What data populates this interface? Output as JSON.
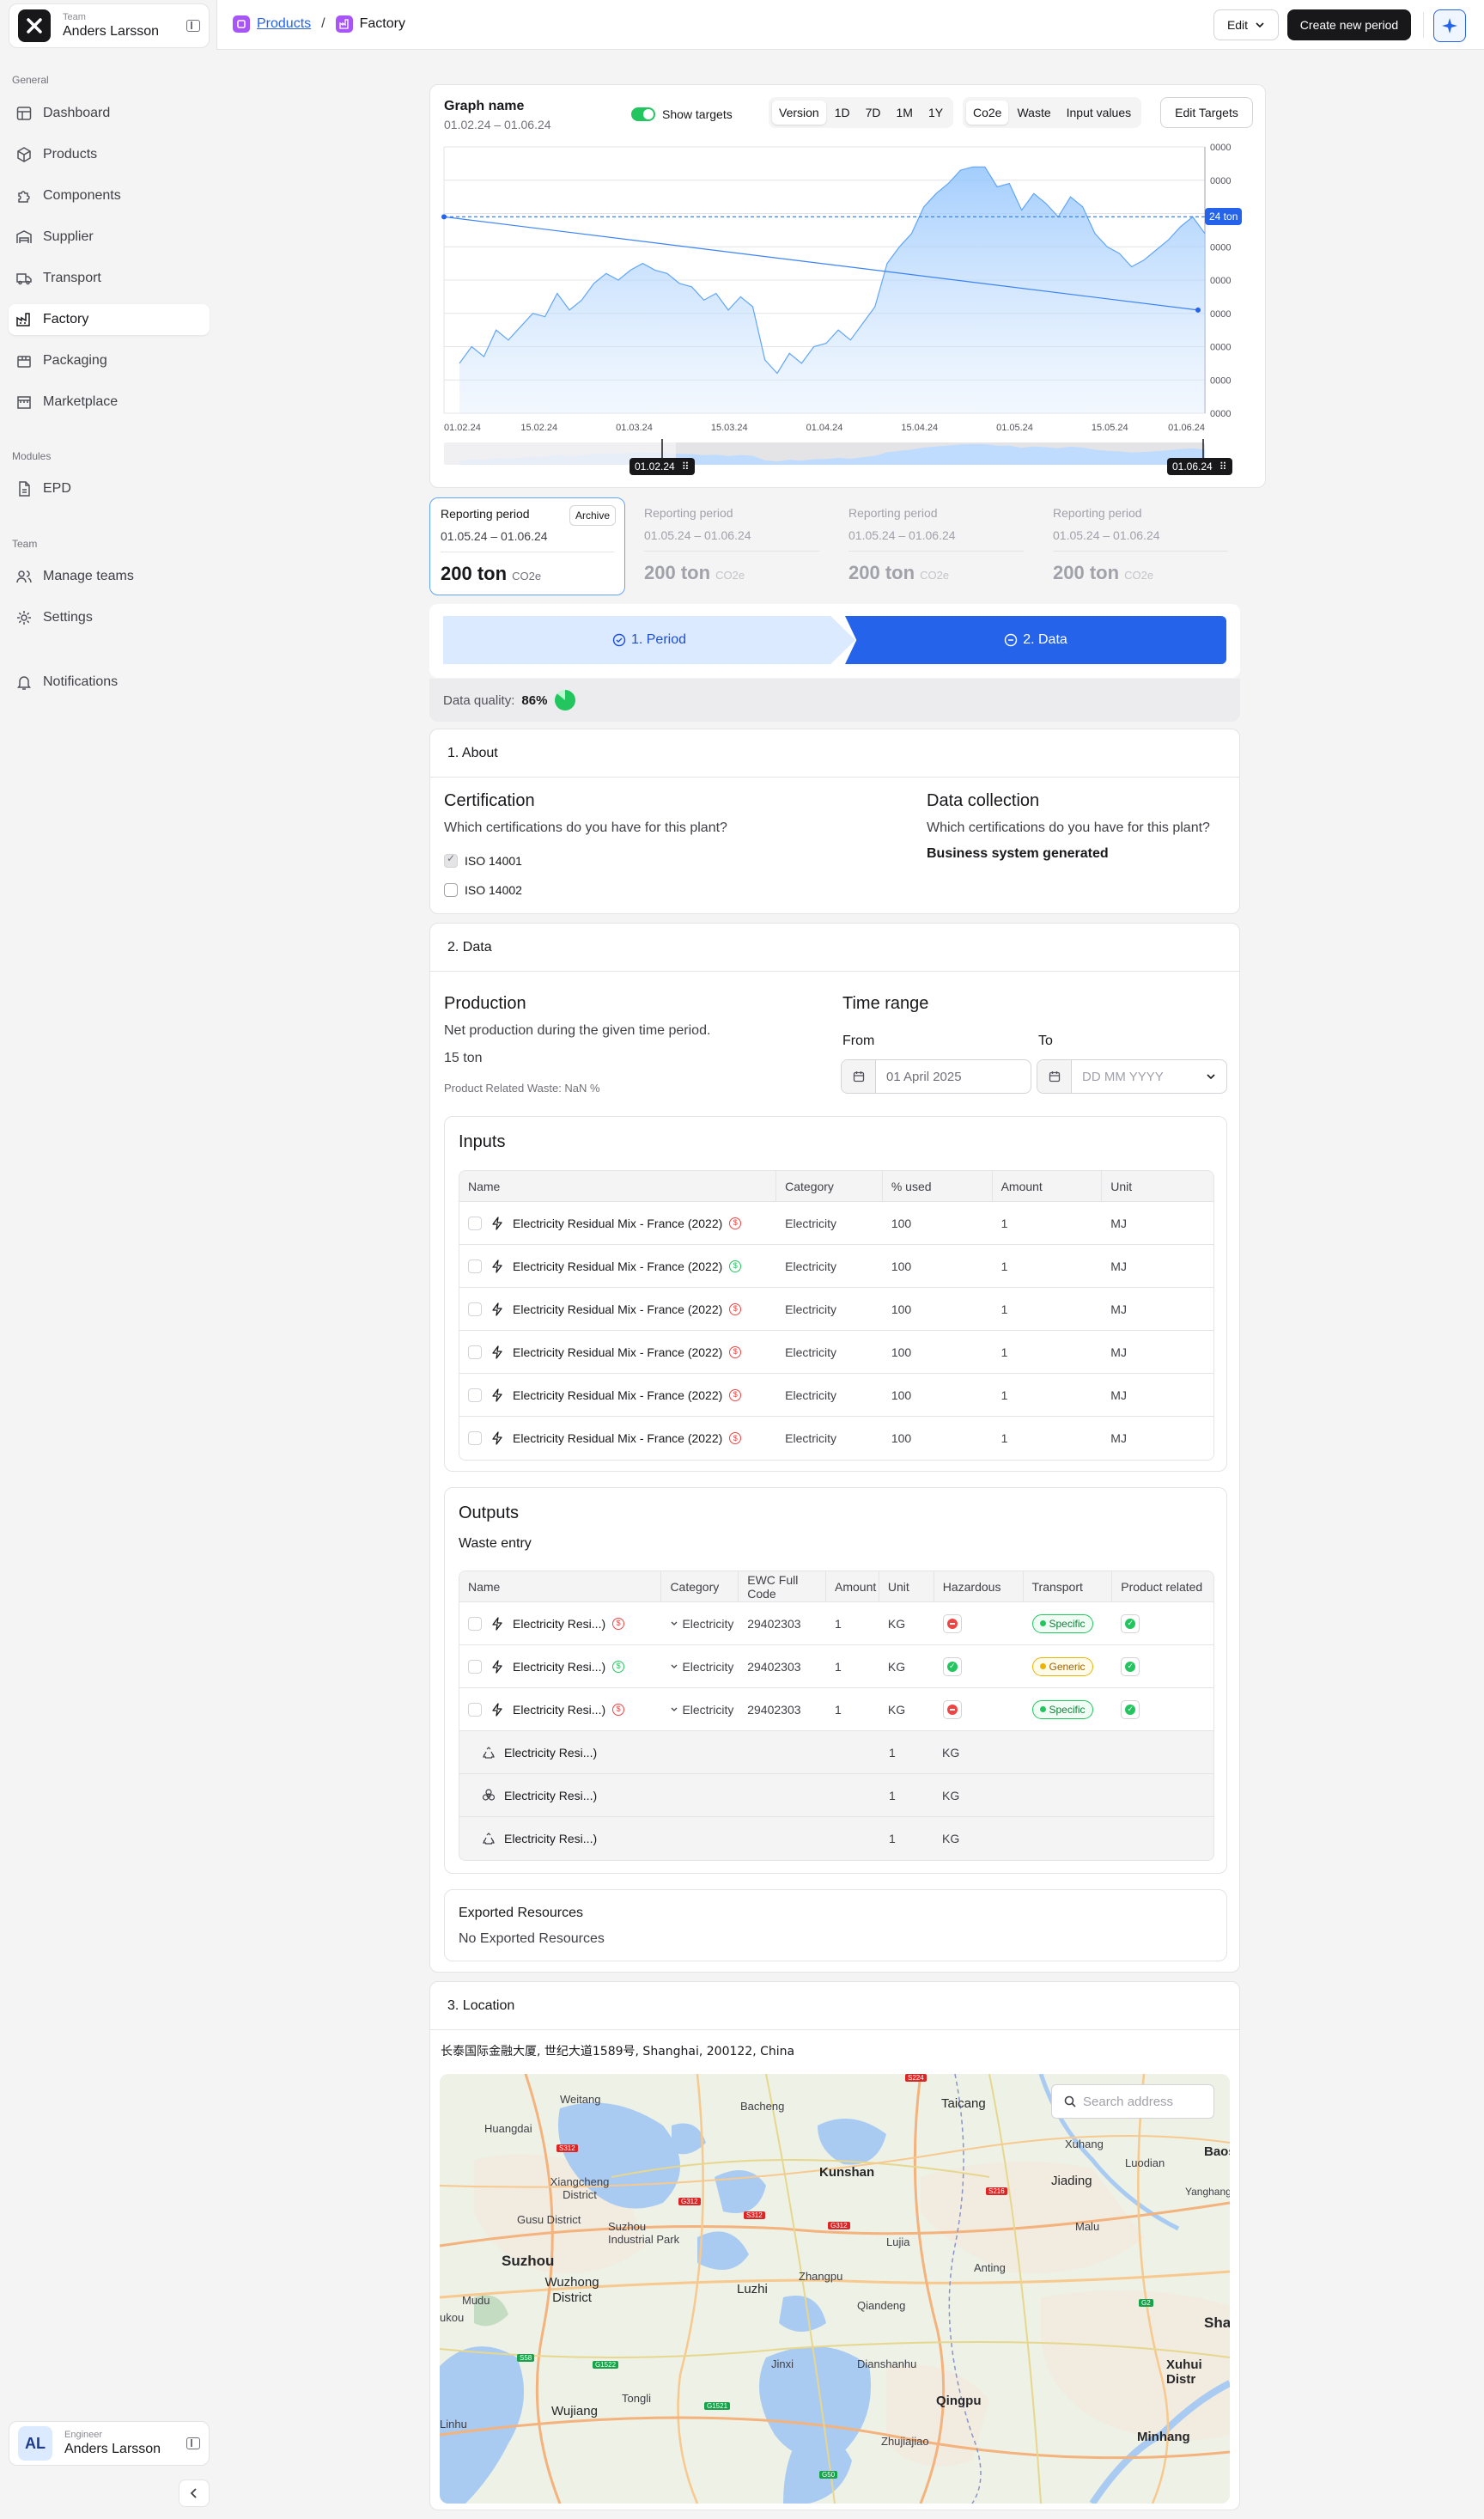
{
  "sidebar": {
    "team_small": "Team",
    "team_name": "Anders Larsson",
    "general_label": "General",
    "nav": [
      {
        "label": "Dashboard",
        "icon": "layout-icon"
      },
      {
        "label": "Products",
        "icon": "box-icon"
      },
      {
        "label": "Components",
        "icon": "puzzle-icon"
      },
      {
        "label": "Supplier",
        "icon": "warehouse-icon"
      },
      {
        "label": "Transport",
        "icon": "truck-icon"
      },
      {
        "label": "Factory",
        "icon": "factory-icon"
      },
      {
        "label": "Packaging",
        "icon": "package-icon"
      },
      {
        "label": "Marketplace",
        "icon": "store-icon"
      }
    ],
    "modules_label": "Modules",
    "modules": [
      {
        "label": "EPD",
        "icon": "document-icon"
      }
    ],
    "team_label": "Team",
    "team_nav": [
      {
        "label": "Manage teams",
        "icon": "users-icon"
      },
      {
        "label": "Settings",
        "icon": "gear-icon"
      }
    ],
    "notifications": "Notifications",
    "user_role": "Engineer",
    "user_name": "Anders Larsson",
    "user_initials": "AL"
  },
  "topbar": {
    "crumb_parent": "Products",
    "crumb_separator": "/",
    "crumb_current": "Factory",
    "edit_label": "Edit",
    "create_label": "Create new period"
  },
  "graph": {
    "title": "Graph name",
    "range": "01.02.24 – 01.06.24",
    "show_targets": "Show targets",
    "ranges": [
      "Version",
      "1D",
      "7D",
      "1M",
      "1Y"
    ],
    "metrics": [
      "Co2e",
      "Waste",
      "Input values"
    ],
    "edit_targets": "Edit Targets",
    "target_badge": "24 ton",
    "brush_start": "01.02.24",
    "brush_end": "01.06.24"
  },
  "chart_data": {
    "type": "area",
    "title": "Graph name",
    "x": [
      "01.02.24",
      "15.02.24",
      "01.03.24",
      "15.03.24",
      "01.04.24",
      "15.04.24",
      "01.05.24",
      "15.05.24",
      "01.06.24"
    ],
    "ytick_labels": [
      "0000",
      "0000",
      "0000",
      "0000",
      "0000",
      "0000",
      "0000",
      "0000",
      "0000"
    ],
    "ylim": [
      0,
      8
    ],
    "series": [
      {
        "values": [
          1.5,
          2.0,
          1.7,
          2.5,
          2.2,
          2.6,
          3.0,
          2.9,
          3.6,
          3.1,
          3.4,
          3.9,
          4.2,
          4.0,
          4.3,
          4.5,
          4.3,
          4.2,
          3.9,
          3.8,
          3.4,
          3.6,
          3.1,
          3.5,
          3.2,
          1.6,
          1.2,
          1.8,
          1.5,
          2.0,
          2.1,
          2.5,
          2.2,
          2.7,
          3.2,
          4.5,
          5.0,
          5.4,
          6.2,
          6.6,
          6.9,
          7.3,
          7.4,
          7.4,
          6.8,
          6.9,
          6.1,
          6.6,
          6.3,
          5.9,
          6.5,
          6.2,
          5.4,
          5.0,
          4.8,
          4.4,
          4.6,
          4.9,
          5.2,
          5.6,
          5.9,
          5.4
        ]
      },
      {
        "values": [
          5.9,
          3.1
        ]
      }
    ],
    "targets": [
      5.9
    ],
    "grid": true
  },
  "periods": [
    {
      "label": "Reporting period",
      "range": "01.05.24 – 01.06.24",
      "value": "200 ton",
      "unit": "CO2e",
      "archive": "Archive"
    },
    {
      "label": "Reporting period",
      "range": "01.05.24 – 01.06.24",
      "value": "200 ton",
      "unit": "CO2e"
    },
    {
      "label": "Reporting period",
      "range": "01.05.24 – 01.06.24",
      "value": "200 ton",
      "unit": "CO2e"
    },
    {
      "label": "Reporting period",
      "range": "01.05.24 – 01.06.24",
      "value": "200 ton",
      "unit": "CO2e"
    }
  ],
  "steps": {
    "step1": "1. Period",
    "step2": "2. Data"
  },
  "data_quality": {
    "label": "Data quality:",
    "value": "86%",
    "fraction": 0.86
  },
  "about": {
    "title": "1. About",
    "cert_title": "Certification",
    "cert_question": "Which certifications do you have for this plant?",
    "certs": [
      {
        "label": "ISO 14001",
        "checked": true
      },
      {
        "label": "ISO 14002",
        "checked": false
      }
    ],
    "dc_title": "Data collection",
    "dc_question": "Which certifications do you have for this plant?",
    "dc_value": "Business system generated"
  },
  "data": {
    "title": "2. Data",
    "prod_title": "Production",
    "prod_desc": "Net production during the given time period.",
    "prod_value": "15 ton",
    "prod_waste": "Product Related Waste: NaN %",
    "time_title": "Time range",
    "from_label": "From",
    "from_value": "01 April 2025",
    "to_label": "To",
    "to_placeholder": "DD MM YYYY"
  },
  "inputs": {
    "title": "Inputs",
    "columns": [
      "Name",
      "Category",
      "% used",
      "Amount",
      "Unit"
    ],
    "rows": [
      {
        "name": "Electricity Residual Mix - France (2022)",
        "flag": "red",
        "category": "Electricity",
        "used": "100",
        "amount": "1",
        "unit": "MJ"
      },
      {
        "name": "Electricity Residual Mix - France (2022)",
        "flag": "green",
        "category": "Electricity",
        "used": "100",
        "amount": "1",
        "unit": "MJ"
      },
      {
        "name": "Electricity Residual Mix - France (2022)",
        "flag": "red",
        "category": "Electricity",
        "used": "100",
        "amount": "1",
        "unit": "MJ"
      },
      {
        "name": "Electricity Residual Mix - France (2022)",
        "flag": "red",
        "category": "Electricity",
        "used": "100",
        "amount": "1",
        "unit": "MJ"
      },
      {
        "name": "Electricity Residual Mix - France (2022)",
        "flag": "red",
        "category": "Electricity",
        "used": "100",
        "amount": "1",
        "unit": "MJ"
      },
      {
        "name": "Electricity Residual Mix - France (2022)",
        "flag": "red",
        "category": "Electricity",
        "used": "100",
        "amount": "1",
        "unit": "MJ"
      }
    ]
  },
  "outputs": {
    "title": "Outputs",
    "subtitle": "Waste entry",
    "columns": [
      "Name",
      "Category",
      "EWC Full Code",
      "Amount",
      "Unit",
      "Hazardous",
      "Transport",
      "Product related"
    ],
    "rows": [
      {
        "name": "Electricity Resi...)",
        "flag": "red",
        "category": "Electricity",
        "ewc": "29402303",
        "amount": "1",
        "unit": "KG",
        "hazardous": "no",
        "transport": "Specific"
      },
      {
        "name": "Electricity Resi...)",
        "flag": "green",
        "category": "Electricity",
        "ewc": "29402303",
        "amount": "1",
        "unit": "KG",
        "hazardous": "yes",
        "transport": "Generic"
      },
      {
        "name": "Electricity Resi...)",
        "flag": "red",
        "category": "Electricity",
        "ewc": "29402303",
        "amount": "1",
        "unit": "KG",
        "hazardous": "no",
        "transport": "Specific"
      }
    ],
    "sub_rows": [
      {
        "name": "Electricity Resi...)",
        "icon": "recycle-icon",
        "amount": "1",
        "unit": "KG"
      },
      {
        "name": "Electricity Resi...)",
        "icon": "biohazard-icon",
        "amount": "1",
        "unit": "KG"
      },
      {
        "name": "Electricity Resi...)",
        "icon": "recycle-icon",
        "amount": "1",
        "unit": "KG"
      }
    ],
    "exported_title": "Exported Resources",
    "exported_value": "No Exported Resources"
  },
  "location": {
    "title": "3. Location",
    "address": "长泰国际金融大厦, 世纪大道1589号, Shanghai, 200122, China",
    "search_placeholder": "Search address",
    "labels": {
      "suzhou": "Suzhou",
      "wuzhong": "Wuzhong District",
      "xiangcheng": "Xiangcheng District",
      "gusu": "Gusu District",
      "sip": "Suzhou Industrial Park",
      "kunshan": "Kunshan",
      "taicang": "Taicang",
      "bacheng": "Bacheng",
      "weitang": "Weitang",
      "huangdai": "Huangdai",
      "xuhang": "Xuhang",
      "jiading": "Jiading",
      "luodian": "Luodian",
      "malu": "Malu",
      "anting": "Anting",
      "zhangpu": "Zhangpu",
      "luzhi": "Luzhi",
      "qiandeng": "Qiandeng",
      "jinxi": "Jinxi",
      "dianshanhu": "Dianshanhu",
      "qingpu": "Qingpu",
      "zhujiajiao": "Zhujiajiao",
      "tongli": "Tongli",
      "wujiang": "Wujiang",
      "linhu": "Linhu",
      "mudu": "Mudu",
      "minhang": "Minhang",
      "xuhui": "Xuhui Distr",
      "sha": "Sha",
      "baos": "Baos",
      "yanghang": "Yanghang",
      "lujia": "Lujia",
      "lukou": "ukou"
    }
  }
}
